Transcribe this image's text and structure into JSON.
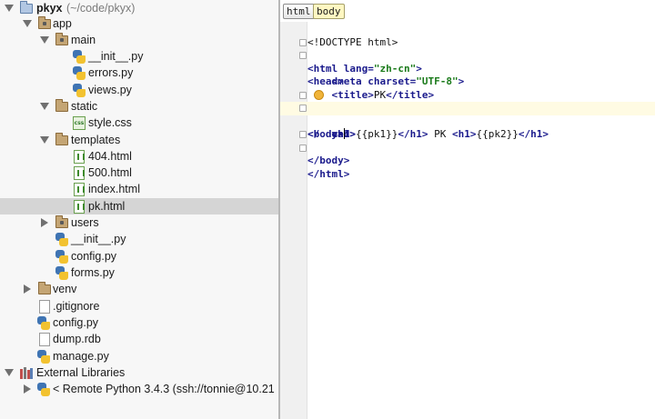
{
  "project_tree": {
    "root": {
      "name": "pkyx",
      "path": "(~/code/pkyx)"
    },
    "items": [
      {
        "label": "app"
      },
      {
        "label": "main"
      },
      {
        "label": "__init__.py"
      },
      {
        "label": "errors.py"
      },
      {
        "label": "views.py"
      },
      {
        "label": "static"
      },
      {
        "label": "style.css"
      },
      {
        "label": "templates"
      },
      {
        "label": "404.html"
      },
      {
        "label": "500.html"
      },
      {
        "label": "index.html"
      },
      {
        "label": "pk.html"
      },
      {
        "label": "users"
      },
      {
        "label": "__init__.py"
      },
      {
        "label": "config.py"
      },
      {
        "label": "forms.py"
      },
      {
        "label": "venv"
      },
      {
        "label": ".gitignore"
      },
      {
        "label": "config.py"
      },
      {
        "label": "dump.rdb"
      },
      {
        "label": "manage.py"
      },
      {
        "label": "External Libraries"
      },
      {
        "label": "< Remote Python 3.4.3 (ssh://tonnie@10.21"
      }
    ],
    "selected": "pk.html"
  },
  "editor": {
    "breadcrumbs": [
      "html",
      "body"
    ],
    "code": {
      "doctype": "<!DOCTYPE html>",
      "html_open": "<html",
      "lang_attr": "lang=",
      "lang_val": "\"zh-cn\"",
      "gt": ">",
      "head_open": "<head>",
      "meta_open": "<meta",
      "charset_attr": "charset=",
      "charset_val": "\"UTF-8\"",
      "title_open": "<title>",
      "title_text": "PK",
      "title_close": "</title>",
      "head_close_a": "</",
      "head_close_b": "ead>",
      "body_open": "<body>",
      "h1_open": "<h1>",
      "pk1": "{{pk1}}",
      "h1_close": "</h1>",
      "pk_word": " PK ",
      "pk2": "{{pk2}}",
      "body_close": "</body>",
      "html_close": "</html>"
    }
  },
  "colors": {
    "tag": "#1a1a8c",
    "string": "#1a7a1a",
    "selection": "#d5d5d5",
    "current_line": "#fffbe3"
  }
}
